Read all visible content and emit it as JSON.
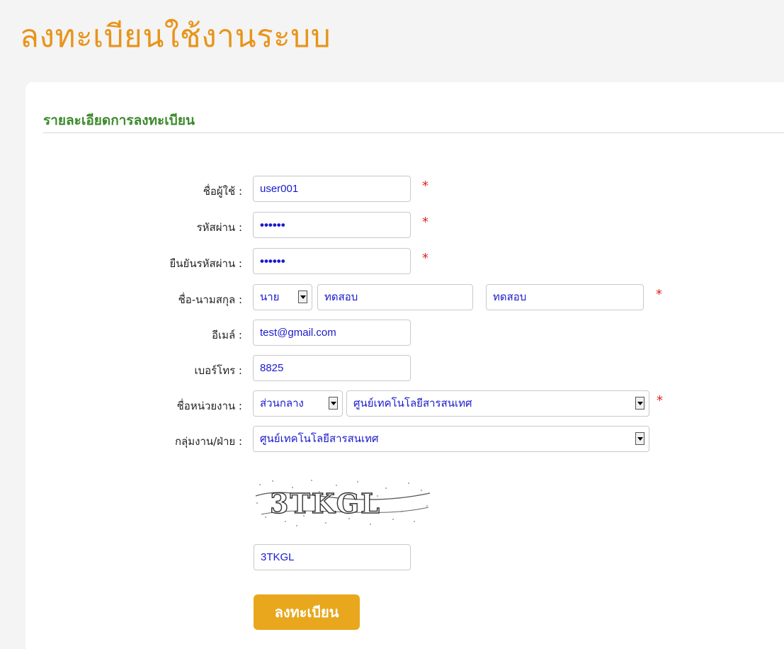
{
  "page": {
    "title": "ลงทะเบียนใช้งานระบบ"
  },
  "section": {
    "title": "รายละเอียดการลงทะเบียน"
  },
  "form": {
    "username": {
      "label": "ชื่อผู้ใช้ :",
      "value": "user001"
    },
    "password": {
      "label": "รหัสผ่าน :",
      "value": "••••••"
    },
    "confirm_password": {
      "label": "ยืนยันรหัสผ่าน :",
      "value": "••••••"
    },
    "fullname": {
      "label": "ชื่อ-นามสกุล :",
      "prefix": "นาย",
      "first_name": "ทดสอบ",
      "last_name": "ทดสอบ"
    },
    "email": {
      "label": "อีเมล์ :",
      "value": "test@gmail.com"
    },
    "phone": {
      "label": "เบอร์โทร :",
      "value": "8825"
    },
    "department": {
      "label": "ชื่อหน่วยงาน :",
      "region": "ส่วนกลาง",
      "unit": "ศูนย์เทคโนโลยีสารสนเทศ"
    },
    "division": {
      "label": "กลุ่มงาน/ฝ่าย :",
      "value": "ศูนย์เทคโนโลยีสารสนเทศ"
    },
    "required_mark": "*",
    "captcha": {
      "image_text": "3TKGL",
      "value": "3TKGL"
    },
    "submit_label": "ลงทะเบียน"
  },
  "colors": {
    "title": "#e8941a",
    "section_title": "#3d8a2c",
    "required": "#e02020",
    "submit_bg": "#e8a71c",
    "input_text": "#1a1acc"
  }
}
